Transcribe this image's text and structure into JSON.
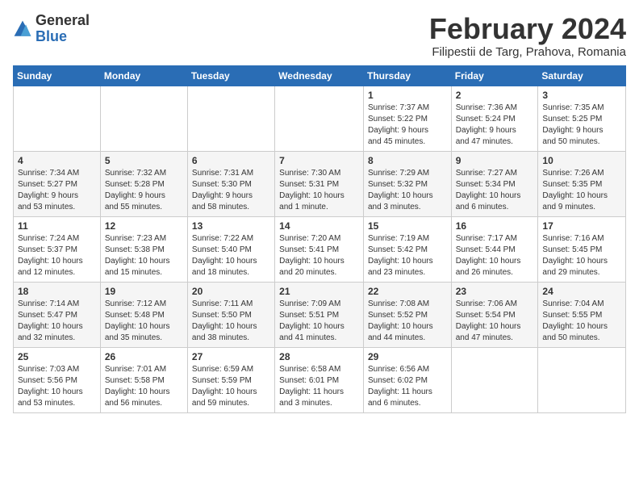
{
  "header": {
    "logo_general": "General",
    "logo_blue": "Blue",
    "main_title": "February 2024",
    "sub_title": "Filipestii de Targ, Prahova, Romania"
  },
  "weekdays": [
    "Sunday",
    "Monday",
    "Tuesday",
    "Wednesday",
    "Thursday",
    "Friday",
    "Saturday"
  ],
  "weeks": [
    [
      {
        "day": "",
        "info": ""
      },
      {
        "day": "",
        "info": ""
      },
      {
        "day": "",
        "info": ""
      },
      {
        "day": "",
        "info": ""
      },
      {
        "day": "1",
        "info": "Sunrise: 7:37 AM\nSunset: 5:22 PM\nDaylight: 9 hours\nand 45 minutes."
      },
      {
        "day": "2",
        "info": "Sunrise: 7:36 AM\nSunset: 5:24 PM\nDaylight: 9 hours\nand 47 minutes."
      },
      {
        "day": "3",
        "info": "Sunrise: 7:35 AM\nSunset: 5:25 PM\nDaylight: 9 hours\nand 50 minutes."
      }
    ],
    [
      {
        "day": "4",
        "info": "Sunrise: 7:34 AM\nSunset: 5:27 PM\nDaylight: 9 hours\nand 53 minutes."
      },
      {
        "day": "5",
        "info": "Sunrise: 7:32 AM\nSunset: 5:28 PM\nDaylight: 9 hours\nand 55 minutes."
      },
      {
        "day": "6",
        "info": "Sunrise: 7:31 AM\nSunset: 5:30 PM\nDaylight: 9 hours\nand 58 minutes."
      },
      {
        "day": "7",
        "info": "Sunrise: 7:30 AM\nSunset: 5:31 PM\nDaylight: 10 hours\nand 1 minute."
      },
      {
        "day": "8",
        "info": "Sunrise: 7:29 AM\nSunset: 5:32 PM\nDaylight: 10 hours\nand 3 minutes."
      },
      {
        "day": "9",
        "info": "Sunrise: 7:27 AM\nSunset: 5:34 PM\nDaylight: 10 hours\nand 6 minutes."
      },
      {
        "day": "10",
        "info": "Sunrise: 7:26 AM\nSunset: 5:35 PM\nDaylight: 10 hours\nand 9 minutes."
      }
    ],
    [
      {
        "day": "11",
        "info": "Sunrise: 7:24 AM\nSunset: 5:37 PM\nDaylight: 10 hours\nand 12 minutes."
      },
      {
        "day": "12",
        "info": "Sunrise: 7:23 AM\nSunset: 5:38 PM\nDaylight: 10 hours\nand 15 minutes."
      },
      {
        "day": "13",
        "info": "Sunrise: 7:22 AM\nSunset: 5:40 PM\nDaylight: 10 hours\nand 18 minutes."
      },
      {
        "day": "14",
        "info": "Sunrise: 7:20 AM\nSunset: 5:41 PM\nDaylight: 10 hours\nand 20 minutes."
      },
      {
        "day": "15",
        "info": "Sunrise: 7:19 AM\nSunset: 5:42 PM\nDaylight: 10 hours\nand 23 minutes."
      },
      {
        "day": "16",
        "info": "Sunrise: 7:17 AM\nSunset: 5:44 PM\nDaylight: 10 hours\nand 26 minutes."
      },
      {
        "day": "17",
        "info": "Sunrise: 7:16 AM\nSunset: 5:45 PM\nDaylight: 10 hours\nand 29 minutes."
      }
    ],
    [
      {
        "day": "18",
        "info": "Sunrise: 7:14 AM\nSunset: 5:47 PM\nDaylight: 10 hours\nand 32 minutes."
      },
      {
        "day": "19",
        "info": "Sunrise: 7:12 AM\nSunset: 5:48 PM\nDaylight: 10 hours\nand 35 minutes."
      },
      {
        "day": "20",
        "info": "Sunrise: 7:11 AM\nSunset: 5:50 PM\nDaylight: 10 hours\nand 38 minutes."
      },
      {
        "day": "21",
        "info": "Sunrise: 7:09 AM\nSunset: 5:51 PM\nDaylight: 10 hours\nand 41 minutes."
      },
      {
        "day": "22",
        "info": "Sunrise: 7:08 AM\nSunset: 5:52 PM\nDaylight: 10 hours\nand 44 minutes."
      },
      {
        "day": "23",
        "info": "Sunrise: 7:06 AM\nSunset: 5:54 PM\nDaylight: 10 hours\nand 47 minutes."
      },
      {
        "day": "24",
        "info": "Sunrise: 7:04 AM\nSunset: 5:55 PM\nDaylight: 10 hours\nand 50 minutes."
      }
    ],
    [
      {
        "day": "25",
        "info": "Sunrise: 7:03 AM\nSunset: 5:56 PM\nDaylight: 10 hours\nand 53 minutes."
      },
      {
        "day": "26",
        "info": "Sunrise: 7:01 AM\nSunset: 5:58 PM\nDaylight: 10 hours\nand 56 minutes."
      },
      {
        "day": "27",
        "info": "Sunrise: 6:59 AM\nSunset: 5:59 PM\nDaylight: 10 hours\nand 59 minutes."
      },
      {
        "day": "28",
        "info": "Sunrise: 6:58 AM\nSunset: 6:01 PM\nDaylight: 11 hours\nand 3 minutes."
      },
      {
        "day": "29",
        "info": "Sunrise: 6:56 AM\nSunset: 6:02 PM\nDaylight: 11 hours\nand 6 minutes."
      },
      {
        "day": "",
        "info": ""
      },
      {
        "day": "",
        "info": ""
      }
    ]
  ],
  "colors": {
    "header_bg": "#2a6db5",
    "accent": "#2a6db5"
  }
}
